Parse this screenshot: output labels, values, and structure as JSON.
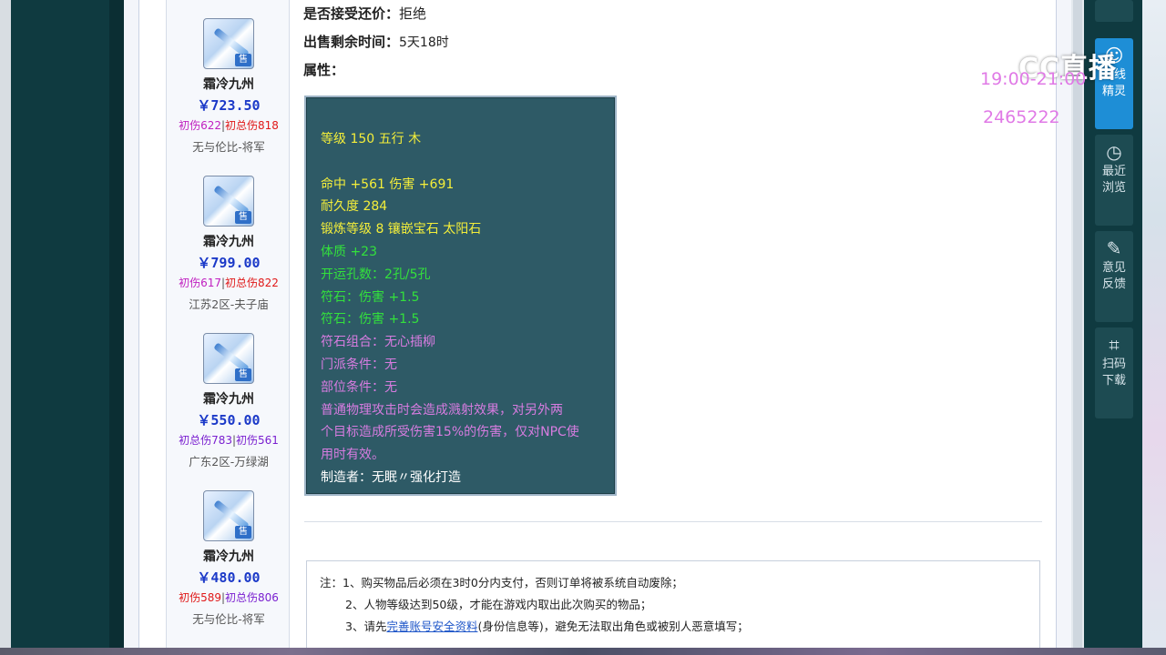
{
  "listing": [
    {
      "name": "霜冷九州",
      "price": "￥723.50",
      "stat1": "初伤622",
      "stat2": "初总伤818",
      "server": "无与伦比-将军"
    },
    {
      "name": "霜冷九州",
      "price": "￥799.00",
      "stat1": "初伤617",
      "stat2": "初总伤822",
      "server": "江苏2区-夫子庙"
    },
    {
      "name": "霜冷九州",
      "price": "￥550.00",
      "stat1": "初总伤783",
      "stat2": "初伤561",
      "server": "广东2区-万绿湖"
    },
    {
      "name": "霜冷九州",
      "price": "￥480.00",
      "stat1": "初伤589",
      "stat2": "初总伤806",
      "server": "无与伦比-将军"
    }
  ],
  "sell_badge": "售",
  "detail": {
    "counter_offer_label": "是否接受还价：",
    "counter_offer_value": "拒绝",
    "remaining_label": "出售剩余时间：",
    "remaining_value": "5天18时",
    "attr_label": "属性："
  },
  "attributes": {
    "level_line": "等级 150 五行 木",
    "hit_line": "命中 +561 伤害 +691",
    "durability": "耐久度 284",
    "forge": "锻炼等级 8 镶嵌宝石 太阳石",
    "physique": "体质 +23",
    "holes": "开运孔数：2孔/5孔",
    "rune1": "符石：伤害 +1.5",
    "rune2": "符石：伤害 +1.5",
    "rune_combo": "符石组合：无心插柳",
    "school_cond": "门派条件：无",
    "part_cond": "部位条件：无",
    "effect1": "普通物理攻击时会造成溅射效果，对另外两",
    "effect2": "个目标造成所受伤害15%的伤害，仅对NPC使",
    "effect3": "用时有效。",
    "maker": "制造者：无眠〃强化打造"
  },
  "notice": {
    "line1": "注：1、购买物品后必须在3时0分内支付，否则订单将被系统自动废除；",
    "line2": "2、人物等级达到50级，才能在游戏内取出此次购买的物品；",
    "line3_a": "3、请先",
    "line3_link": "完善账号安全资料",
    "line3_b": "(身份信息等)，避免无法取出角色或被别人恶意填写；"
  },
  "overlay": {
    "logo": "CC直播",
    "time": "19:00-21:00",
    "code": "2465222"
  },
  "tools": [
    {
      "icon": "chat-icon",
      "title": "在线精灵"
    },
    {
      "icon": "clock-icon",
      "title": "最近浏览"
    },
    {
      "icon": "edit-icon",
      "title": "意见反馈"
    },
    {
      "icon": "scan-icon",
      "title": "扫码下载"
    }
  ],
  "colors": {
    "price": "#1b39c8",
    "attr_bg": "#2e5a66",
    "yellow": "#f4ee3a",
    "green": "#33e13c",
    "purple": "#d77ce0",
    "accent": "#1e8ed6"
  }
}
